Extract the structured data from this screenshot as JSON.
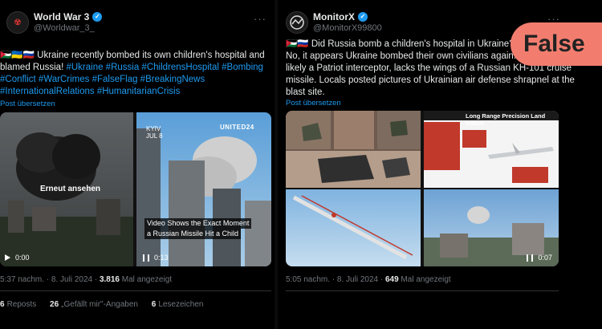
{
  "left": {
    "display_name": "World War 3",
    "handle": "@Worldwar_3_",
    "avatar_text": "☢",
    "more": "···",
    "lines": [
      [
        "🇯🇴🇺🇦🇷🇺 Ukraine recently bombed its own children's hospital and",
        null
      ],
      [
        "blamed Russia! ",
        "#Ukraine #Russia #ChildrensHospital #Bombing"
      ],
      [
        "",
        "#Conflict #WarCrimes #FalseFlag #BreakingNews"
      ],
      [
        "",
        "#InternationalRelations #HumanitarianCrisis"
      ]
    ],
    "translate": "Post übersetzen",
    "video1": {
      "overlay": "Erneut ansehen",
      "time": "0:00"
    },
    "video2": {
      "city": "KYIV",
      "date": "JUL 8",
      "channel": "UNITED24",
      "caption_line1": "Video Shows the Exact Moment",
      "caption_line2": "a Russian Missile Hit a Child",
      "time": "0:13"
    },
    "timestamp": "5:37 nachm. · 8. Juli 2024 · ",
    "views_count": "3.816",
    "views_label": " Mal angezeigt",
    "stats": [
      {
        "count": "6",
        "label": "Reposts"
      },
      {
        "count": "26",
        "label": "„Gefällt mir\"-Angaben"
      },
      {
        "count": "6",
        "label": "Lesezeichen"
      }
    ]
  },
  "right": {
    "display_name": "MonitorX",
    "handle": "@MonitorX99800",
    "more": "···",
    "lines": [
      "🇯🇴🇷🇺 Did Russia bomb a children's hospital in Ukraine?",
      "No, it appears Ukraine bombed their own civilians again. The",
      "likely a Patriot interceptor, lacks the wings of a Russian KH-101 cruise",
      "missile. Locals posted pictures of Ukrainian air defense shrapnel at the",
      "blast site."
    ],
    "translate": "Post übersetzen",
    "infographic_title": "Long Range Precision Land Attack.",
    "video_time": "0:07",
    "timestamp": "5:05 nachm. · 8. Juli 2024 · ",
    "views_count": "649",
    "views_label": " Mal angezeigt"
  },
  "badge": {
    "label": "False",
    "color": "#f27d6f"
  }
}
